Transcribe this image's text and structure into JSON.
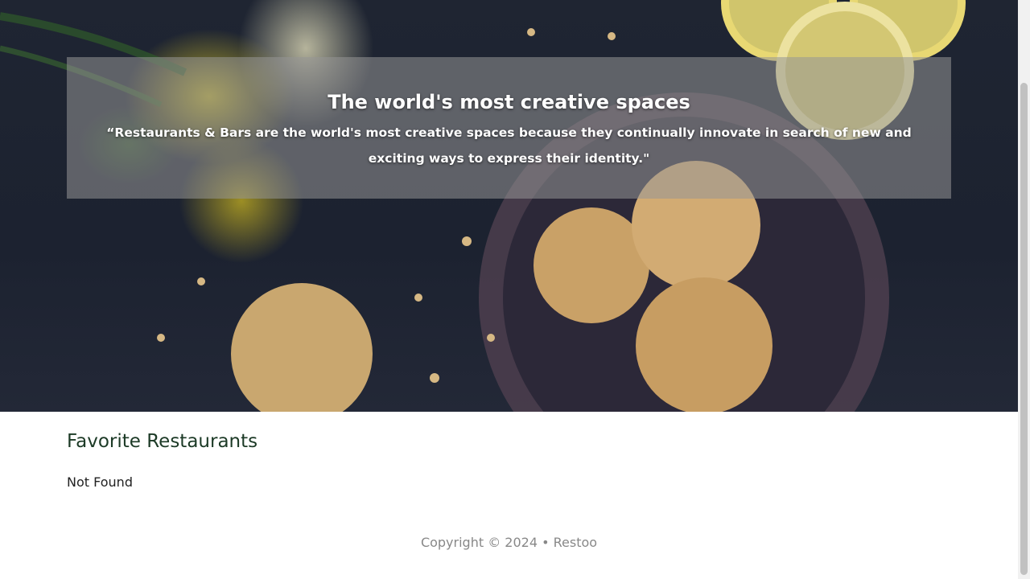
{
  "hero": {
    "title": "The world's most creative spaces",
    "quote": "“Restaurants & Bars are the world's most creative spaces because they continually innovate in search of new and exciting ways to express their identity.\""
  },
  "favorites": {
    "heading": "Favorite Restaurants",
    "empty_message": "Not Found"
  },
  "footer": {
    "copyright": "Copyright © 2024 • Restoo"
  },
  "colors": {
    "heading": "#1c3a26",
    "footer_text": "#888888",
    "overlay": "rgba(150,150,150,0.55)"
  }
}
